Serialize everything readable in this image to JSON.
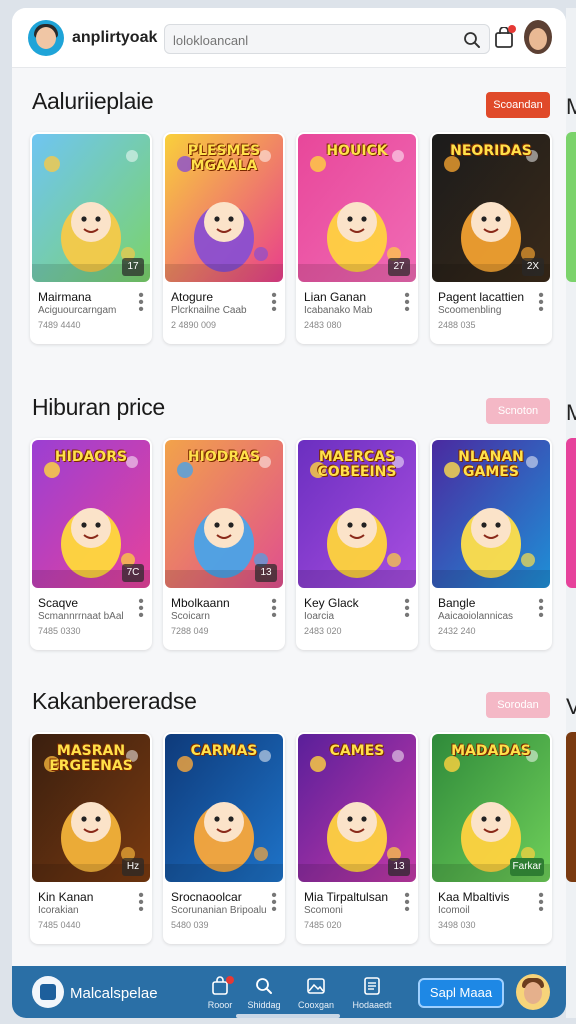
{
  "header": {
    "app_name": "anplirtyoak",
    "search_placeholder": "lolokloancanl",
    "icons": [
      "search-icon",
      "shopping-bag-icon",
      "profile-avatar"
    ]
  },
  "sections": [
    {
      "title": "Aaluriieplaie",
      "button": "Scoandan",
      "button_color": "#e04a2a",
      "cards": [
        {
          "name": "Mairmana",
          "sub": "Aciguourcarngam",
          "num": "7489 4440",
          "badge": "17",
          "art_title": "",
          "palette": [
            "#6fc5f2",
            "#7bd36b",
            "#f7c948"
          ]
        },
        {
          "name": "Atogure",
          "sub": "Plcrknailne Caab",
          "num": "2 4890 009",
          "badge": "",
          "art_title": "PLESMES MGAALA",
          "palette": [
            "#f9d03b",
            "#e83e8c",
            "#8a4fd1"
          ]
        },
        {
          "name": "Lian Ganan",
          "sub": "Icabanako Mab",
          "num": "2483 080",
          "badge": "27",
          "art_title": "HOUICK",
          "palette": [
            "#e8479a",
            "#f06bb5",
            "#ffd23f"
          ]
        },
        {
          "name": "Pagent lacattien",
          "sub": "Scoomenbling",
          "num": "2488 035",
          "badge": "2X",
          "art_title": "NEORIDAS",
          "palette": [
            "#1b1b1b",
            "#3a2a1a",
            "#f0a030"
          ]
        }
      ]
    },
    {
      "title": "Hiburan price",
      "button": "Scnoton",
      "button_color": "#f4b8c6",
      "cards": [
        {
          "name": "Scaqve",
          "sub": "Scmannrrnaat bAal",
          "num": "7485 0330",
          "badge": "7C",
          "art_title": "HIDAORS",
          "palette": [
            "#9b3fd3",
            "#e6429b",
            "#ffd93b"
          ]
        },
        {
          "name": "Mbolkaann",
          "sub": "Scoicarn",
          "num": "7288 049",
          "badge": "13",
          "art_title": "HIODRAS",
          "palette": [
            "#f2a34a",
            "#e04f8e",
            "#4aa3e8"
          ]
        },
        {
          "name": "Key Glack",
          "sub": "Ioarcia",
          "num": "2483 020",
          "badge": "",
          "art_title": "MAERCAS COBEEINS",
          "palette": [
            "#6b2fc0",
            "#a84ee0",
            "#ffd43b"
          ]
        },
        {
          "name": "Bangle",
          "sub": "Aaicaoiolannicas",
          "num": "2432 240",
          "badge": "",
          "art_title": "NLANAN GAMES",
          "palette": [
            "#4a2aa0",
            "#1f8fd6",
            "#ffdf4a"
          ]
        }
      ]
    },
    {
      "title": "Kakanbereradse",
      "button": "Sorodan",
      "button_color": "#f4b8c6",
      "cards": [
        {
          "name": "Kin Kanan",
          "sub": "Icorakian",
          "num": "7485 0440",
          "badge": "Hz",
          "art_title": "MASRAN ERGEENAS",
          "palette": [
            "#3a1f0f",
            "#7a3a10",
            "#f2b23a"
          ]
        },
        {
          "name": "Srocnaoolcar",
          "sub": "Scorunanian Bripoalu",
          "num": "5480 039",
          "badge": "",
          "art_title": "CARMAS",
          "palette": [
            "#0e3a7a",
            "#1e73c8",
            "#f9a83b"
          ]
        },
        {
          "name": "Mia Tirpaltulsan",
          "sub": "Scomoni",
          "num": "7485 020",
          "badge": "13",
          "art_title": "CAMES",
          "palette": [
            "#5a1f9a",
            "#c43aa8",
            "#ffd23f"
          ]
        },
        {
          "name": "Kaa Mbaltivis",
          "sub": "Icomoil",
          "num": "3498 030",
          "badge": "Farkar",
          "art_title": "MADADAS",
          "palette": [
            "#2f8a3a",
            "#6fcf5a",
            "#ffd23f"
          ]
        }
      ]
    }
  ],
  "peek_letters": [
    "M",
    "M",
    "V"
  ],
  "bottom_nav": {
    "app_name": "Malcalspelae",
    "items": [
      {
        "label": "Rooor",
        "icon": "bag-icon"
      },
      {
        "label": "Shiddag",
        "icon": "search-icon"
      },
      {
        "label": "Cooxgan",
        "icon": "image-icon"
      },
      {
        "label": "Hodaaedt",
        "icon": "list-icon"
      }
    ],
    "cta": "Sapl Maaa"
  },
  "colors": {
    "bottom_bar": "#2a6fa6",
    "accent_red": "#e04a2a",
    "accent_pink": "#f4b8c6"
  }
}
